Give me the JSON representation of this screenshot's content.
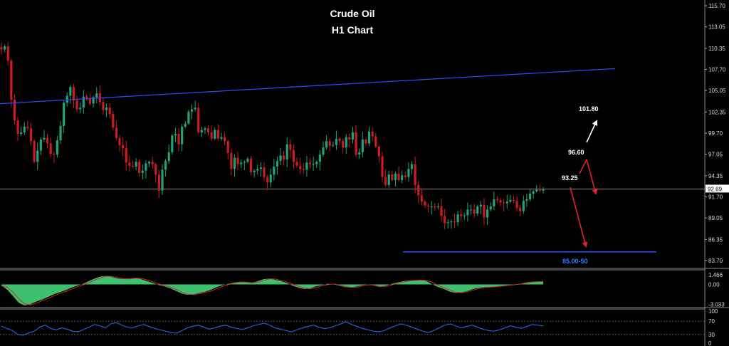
{
  "chart_data": {
    "type": "candlestick",
    "title": "Crude Oil",
    "subtitle": "H1 Chart",
    "price_axis": {
      "ticks": [
        "115.70",
        "113.05",
        "110.35",
        "107.70",
        "105.05",
        "102.35",
        "99.70",
        "97.05",
        "94.35",
        "91.70",
        "89.05",
        "86.35",
        "83.70"
      ],
      "min": 83.7,
      "max": 115.7,
      "current_price": "92.69"
    },
    "price_closes": [
      110.2,
      110.6,
      108.8,
      103.9,
      101.3,
      99.6,
      99.8,
      100.5,
      100.3,
      98.7,
      96.1,
      97.5,
      98.9,
      99.1,
      98.4,
      97.1,
      97.0,
      98.8,
      100.6,
      103.5,
      104.4,
      105.5,
      103.8,
      102.7,
      102.9,
      104.3,
      104.1,
      103.4,
      104.2,
      104.7,
      103.6,
      102.6,
      102.9,
      102.1,
      100.4,
      99.1,
      98.2,
      97.8,
      96.0,
      95.6,
      95.5,
      96.1,
      94.7,
      95.0,
      95.9,
      96.1,
      95.8,
      94.5,
      92.5,
      95.1,
      96.2,
      97.3,
      99.4,
      99.6,
      98.3,
      100.5,
      100.9,
      102.4,
      102.7,
      102.9,
      99.8,
      100.1,
      100.3,
      99.8,
      99.0,
      100.1,
      99.0,
      99.2,
      98.7,
      97.2,
      95.2,
      96.6,
      95.8,
      96.0,
      96.1,
      96.5,
      94.8,
      95.0,
      95.2,
      95.4,
      94.2,
      93.5,
      94.5,
      95.5,
      96.2,
      96.9,
      96.4,
      98.3,
      97.6,
      96.1,
      95.6,
      95.2,
      95.1,
      96.0,
      95.8,
      95.8,
      96.1,
      97.0,
      97.9,
      98.7,
      98.1,
      98.2,
      99.0,
      98.7,
      97.9,
      99.2,
      98.9,
      99.8,
      97.0,
      97.3,
      98.9,
      98.4,
      99.9,
      99.3,
      98.0,
      96.8,
      94.2,
      93.2,
      94.5,
      93.8,
      94.6,
      93.8,
      94.4,
      94.2,
      95.2,
      95.8,
      93.2,
      91.9,
      91.1,
      90.6,
      90.5,
      90.5,
      90.4,
      90.5,
      89.3,
      88.4,
      88.5,
      88.6,
      88.5,
      89.5,
      89.3,
      89.4,
      90.1,
      90.1,
      89.6,
      90.5,
      90.7,
      89.1,
      90.1,
      90.5,
      91.4,
      91.3,
      91.0,
      90.9,
      91.1,
      91.3,
      91.2,
      90.3,
      89.9,
      91.2,
      91.4,
      92.1,
      92.4,
      92.6,
      92.5,
      92.7
    ],
    "annotations": [
      {
        "label": "101.80",
        "color": "#ffffff"
      },
      {
        "label": "96.60",
        "color": "#ffffff"
      },
      {
        "label": "93.25",
        "color": "#ffffff"
      },
      {
        "label": "85.00-50",
        "color": "#2f7fff"
      }
    ],
    "trendline": {
      "from_price": 103.4,
      "to_price": 107.8,
      "color": "#2f4bff"
    },
    "target_level": {
      "price": 84.8,
      "color": "#2f4bff"
    },
    "macd": {
      "ticks": [
        "1.466",
        "0.00",
        "-3.033"
      ],
      "min": -3.3,
      "max": 2.0,
      "hist": [
        -0.2,
        -0.8,
        -1.8,
        -2.8,
        -3.2,
        -3.0,
        -2.6,
        -2.3,
        -1.9,
        -1.5,
        -1.2,
        -0.9,
        -0.5,
        -0.2,
        0.1,
        0.5,
        0.9,
        1.2,
        1.3,
        1.1,
        0.9,
        0.8,
        0.9,
        1.0,
        0.8,
        0.5,
        0.2,
        -0.1,
        -0.3,
        -0.6,
        -1.0,
        -1.4,
        -1.6,
        -1.5,
        -1.3,
        -1.1,
        -0.8,
        -0.4,
        -0.1,
        0.1,
        0.3,
        0.4,
        0.3,
        0.2,
        0.5,
        0.8,
        0.9,
        0.7,
        0.5,
        0.2,
        -0.2,
        -0.5,
        -0.7,
        -0.6,
        -0.3,
        -0.1,
        0.1,
        0.0,
        -0.2,
        -0.4,
        -0.5,
        -0.3,
        -0.1,
        0.0,
        -0.2,
        -0.4,
        -0.2,
        0.1,
        0.3,
        0.5,
        0.6,
        0.6,
        0.7,
        0.5,
        0.0,
        -0.4,
        -0.7,
        -1.1,
        -1.3,
        -1.2,
        -1.0,
        -0.7,
        -0.5,
        -0.4,
        -0.4,
        -0.3,
        -0.2,
        -0.1,
        0.0,
        0.1,
        0.3,
        0.4,
        0.4,
        0.5
      ]
    },
    "rsi": {
      "ticks": [
        "100",
        "70",
        "30",
        "0"
      ],
      "min": 0,
      "max": 100,
      "values": [
        55,
        48,
        42,
        30,
        28,
        35,
        40,
        52,
        58,
        48,
        44,
        50,
        46,
        40,
        38,
        45,
        52,
        60,
        56,
        50,
        62,
        66,
        58,
        52,
        50,
        56,
        60,
        54,
        48,
        44,
        40,
        36,
        34,
        42,
        50,
        55,
        58,
        52,
        46,
        50,
        55,
        58,
        52,
        48,
        45,
        50,
        56,
        60,
        64,
        58,
        50,
        46,
        42,
        38,
        44,
        50,
        54,
        58,
        52,
        48,
        50,
        56,
        62,
        68,
        60,
        54,
        48,
        44,
        40,
        38,
        42,
        50,
        56,
        62,
        58,
        52,
        46,
        40,
        36,
        42,
        50,
        58,
        62,
        56,
        50,
        54,
        58,
        52,
        46,
        42,
        40,
        44,
        50,
        56,
        52,
        48,
        54,
        60,
        58,
        56
      ]
    }
  }
}
